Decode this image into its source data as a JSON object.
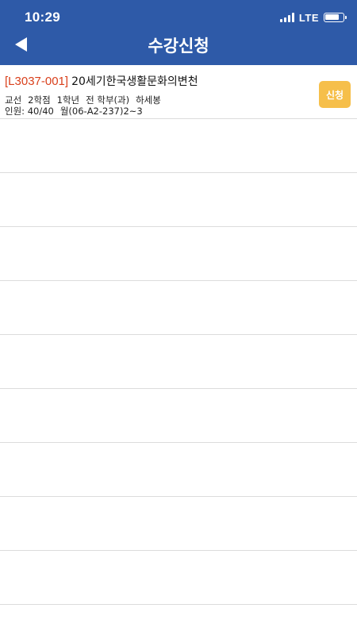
{
  "status": {
    "time": "10:29",
    "network": "LTE",
    "battery_level": 0.8
  },
  "header": {
    "title": "수강신청"
  },
  "courses": [
    {
      "code": "[L3037-001]",
      "name": "20세기한국생활문화의변천",
      "category": "교선",
      "credits": "2학점",
      "grade": "1학년",
      "department": "전 학부(과)",
      "professor": "하세봉",
      "enrollment": "인원: 40/40",
      "schedule": "월(06-A2-237)2~3",
      "apply_label": "신청"
    }
  ]
}
